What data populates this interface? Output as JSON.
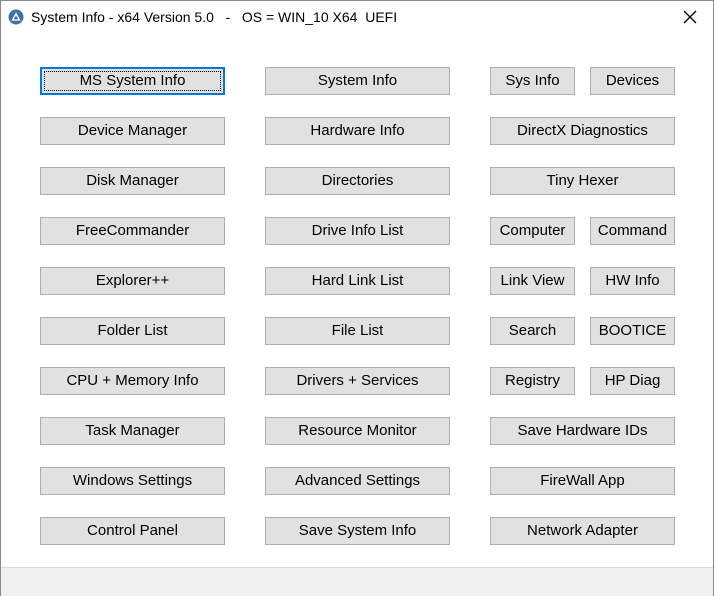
{
  "window": {
    "title": "System Info - x64 Version 5.0   -   OS = WIN_10 X64  UEFI"
  },
  "buttons": {
    "ms_system_info": "MS System Info",
    "system_info": "System Info",
    "sys_info": "Sys Info",
    "devices": "Devices",
    "device_manager": "Device Manager",
    "hardware_info": "Hardware Info",
    "directx_diagnostics": "DirectX Diagnostics",
    "disk_manager": "Disk Manager",
    "directories": "Directories",
    "tiny_hexer": "Tiny Hexer",
    "freecommander": "FreeCommander",
    "drive_info_list": "Drive Info List",
    "computer": "Computer",
    "command": "Command",
    "explorer_pp": "Explorer++",
    "hard_link_list": "Hard Link List",
    "link_view": "Link View",
    "hw_info": "HW Info",
    "folder_list": "Folder List",
    "file_list": "File List",
    "search": "Search",
    "bootice": "BOOTICE",
    "cpu_memory_info": "CPU + Memory Info",
    "drivers_services": "Drivers + Services",
    "registry": "Registry",
    "hp_diag": "HP Diag",
    "task_manager": "Task Manager",
    "resource_monitor": "Resource Monitor",
    "save_hardware_ids": "Save Hardware IDs",
    "windows_settings": "Windows Settings",
    "advanced_settings": "Advanced Settings",
    "firewall_app": "FireWall App",
    "control_panel": "Control Panel",
    "save_system_info": "Save System Info",
    "network_adapter": "Network Adapter"
  },
  "colors": {
    "button_face": "#e1e1e1",
    "button_border": "#adadad",
    "focus_accent": "#0078d7",
    "status_bar": "#f0f0f0"
  },
  "icons": {
    "app": "app-triangle-icon",
    "close": "close-icon"
  }
}
